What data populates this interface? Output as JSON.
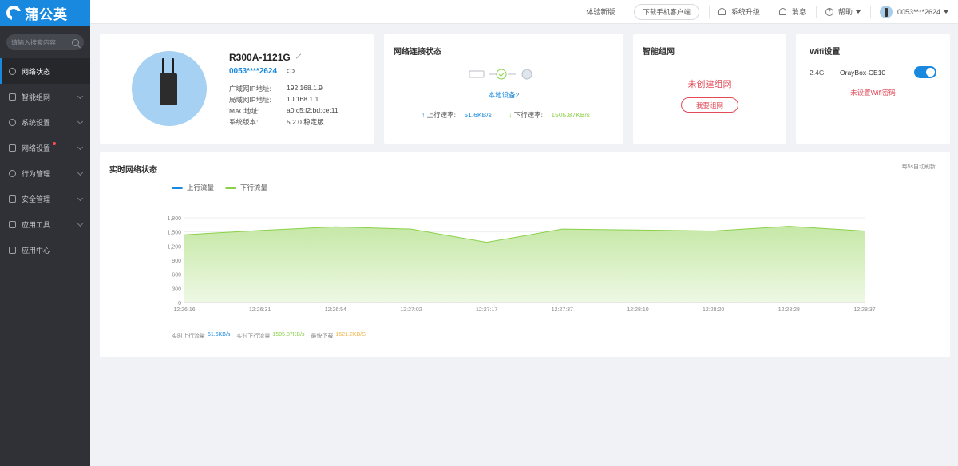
{
  "app": {
    "logo_text": "蒲公英"
  },
  "topbar": {
    "try_new": "体验新版",
    "download_app": "下载手机客户端",
    "upgrade": "系统升级",
    "messages": "消息",
    "help": "帮助",
    "user": "0053****2624"
  },
  "sidebar": {
    "search_placeholder": "请输入搜索内容",
    "items": [
      {
        "label": "网络状态",
        "active": true
      },
      {
        "label": "智能组网"
      },
      {
        "label": "系统设置"
      },
      {
        "label": "网络设置",
        "badge_dot": true
      },
      {
        "label": "行为管理"
      },
      {
        "label": "安全管理"
      },
      {
        "label": "应用工具"
      },
      {
        "label": "应用中心"
      }
    ]
  },
  "device": {
    "model": "R300A-1121G",
    "id": "0053****2624",
    "wan_ip_label": "广域网IP地址:",
    "wan_ip": "192.168.1.9",
    "lan_ip_label": "局域网IP地址:",
    "lan_ip": "10.168.1.1",
    "mac_label": "MAC地址:",
    "mac": "a0:c5:f2:bd:ce:11",
    "version_label": "系统版本:",
    "version": "5.2.0 稳定版"
  },
  "network": {
    "title": "网络连接状态",
    "local_device": "本地设备2",
    "up_label": "上行速率:",
    "up_rate": "51.6KB/s",
    "down_label": "下行速率:",
    "down_rate": "1505.87KB/s"
  },
  "mesh": {
    "title": "智能组网",
    "status": "未创建组网",
    "button": "我要组网"
  },
  "wifi": {
    "title": "Wifi设置",
    "band": "2.4G:",
    "ssid": "OrayBox-CE10",
    "enabled": true,
    "warning": "未设置Wifi密码"
  },
  "realtime": {
    "title": "实时网络状态",
    "auto_refresh": "每5s自动刷新",
    "summary_up_label": "实时上行流量",
    "summary_up": "51.6KB/s",
    "summary_down_label": "实时下行流量",
    "summary_down": "1505.87KB/s",
    "summary_max_label": "最快下载",
    "summary_max": "1621.2KB/S"
  },
  "chart_data": {
    "type": "area",
    "x": [
      "12:26:16",
      "12:26:31",
      "12:26:54",
      "12:27:02",
      "12:27:17",
      "12:27:37",
      "12:28:10",
      "12:28:20",
      "12:28:28",
      "12:28:37"
    ],
    "yticks": [
      0,
      300,
      600,
      900,
      1200,
      1500,
      1800
    ],
    "ytick_labels": [
      "0",
      "300",
      "600",
      "900",
      "1,200",
      "1,500",
      "1,800"
    ],
    "ylim": [
      0,
      1800
    ],
    "series": [
      {
        "name": "上行流量",
        "color": "#1989e0",
        "values": [
          20,
          20,
          20,
          20,
          20,
          20,
          20,
          20,
          20,
          20
        ]
      },
      {
        "name": "下行流量",
        "color": "#8bd14a",
        "values": [
          1440,
          1530,
          1610,
          1560,
          1280,
          1560,
          1540,
          1520,
          1620,
          1520
        ]
      }
    ],
    "grid": true,
    "legend": "top-left"
  }
}
